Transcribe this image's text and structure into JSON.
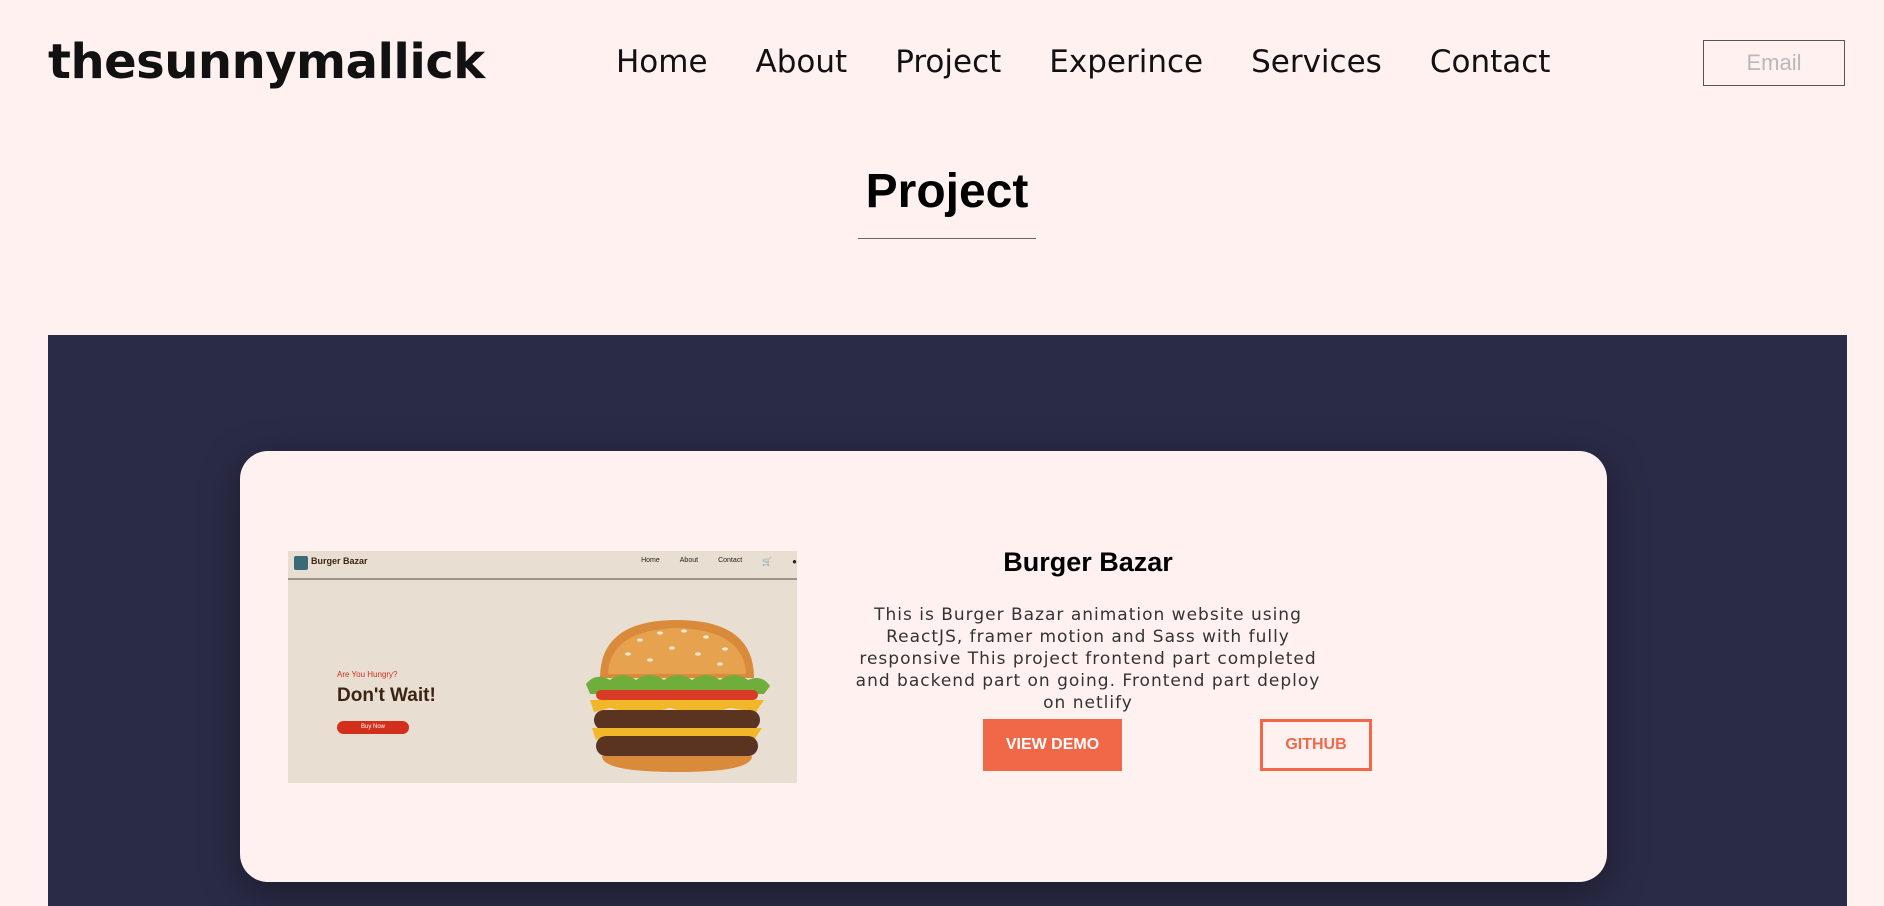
{
  "header": {
    "brand": "thesunnymallick",
    "nav": [
      "Home",
      "About",
      "Project",
      "Experince",
      "Services",
      "Contact"
    ],
    "email_placeholder": "Email"
  },
  "section": {
    "title": "Project"
  },
  "project": {
    "title": "Burger Bazar",
    "description": "This is Burger Bazar animation website using ReactJS, framer motion and Sass with fully responsive This project frontend part completed and backend part on going. Frontend part deploy on netlify",
    "demo_label": "VIEW DEMO",
    "github_label": "GITHUB",
    "preview": {
      "brand": "Burger Bazar",
      "links": [
        "Home",
        "About",
        "Contact"
      ],
      "tagline": "Are You Hungry?",
      "headline": "Don't Wait!",
      "cta": "Buy Now"
    }
  },
  "colors": {
    "background": "#fff1f0",
    "band": "#2a2b46",
    "accent": "#f06848"
  }
}
